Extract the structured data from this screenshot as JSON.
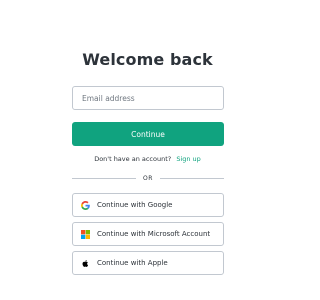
{
  "page": {
    "title": "Welcome back"
  },
  "email": {
    "placeholder": "Email address",
    "value": ""
  },
  "continue_button": {
    "label": "Continue",
    "color": "#10a37f"
  },
  "signup": {
    "prompt": "Don't have an account?",
    "link_label": "Sign up"
  },
  "divider": {
    "label": "OR"
  },
  "social_buttons": [
    {
      "label": "Continue with Google",
      "icon": "google-icon"
    },
    {
      "label": "Continue with Microsoft Account",
      "icon": "microsoft-icon"
    },
    {
      "label": "Continue with Apple",
      "icon": "apple-icon"
    }
  ]
}
